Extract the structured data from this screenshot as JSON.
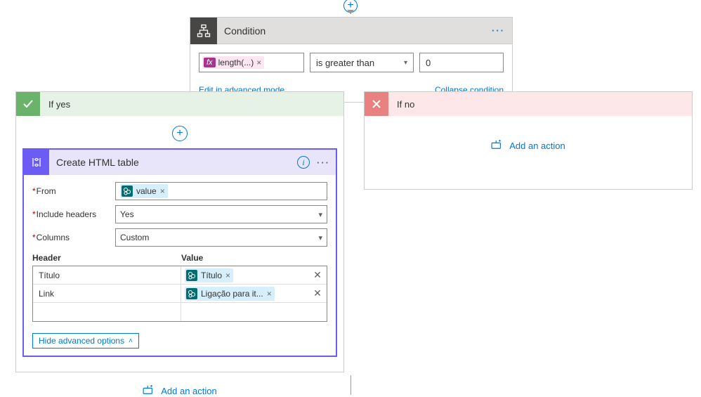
{
  "top": {
    "plus": "+"
  },
  "condition": {
    "title": "Condition",
    "menu": "···",
    "lhs_token": "length(...)",
    "operator": "is greater than",
    "rhs_value": "0",
    "edit_link": "Edit in advanced mode",
    "collapse_link": "Collapse condition"
  },
  "branches": {
    "yes": {
      "title": "If yes",
      "add_circle": "+",
      "add_action": "Add an action"
    },
    "no": {
      "title": "If no",
      "add_action": "Add an action"
    }
  },
  "action": {
    "title": "Create HTML table",
    "info_glyph": "i",
    "menu": "···",
    "labels": {
      "from": "From",
      "include_headers": "Include headers",
      "columns": "Columns",
      "header_col": "Header",
      "value_col": "Value"
    },
    "from_token": "value",
    "include_headers_value": "Yes",
    "columns_value": "Custom",
    "column_rows": [
      {
        "header": "Título",
        "value_token": "Título"
      },
      {
        "header": "Link",
        "value_token": "Ligação para it..."
      }
    ],
    "hide_advanced": "Hide advanced options"
  }
}
